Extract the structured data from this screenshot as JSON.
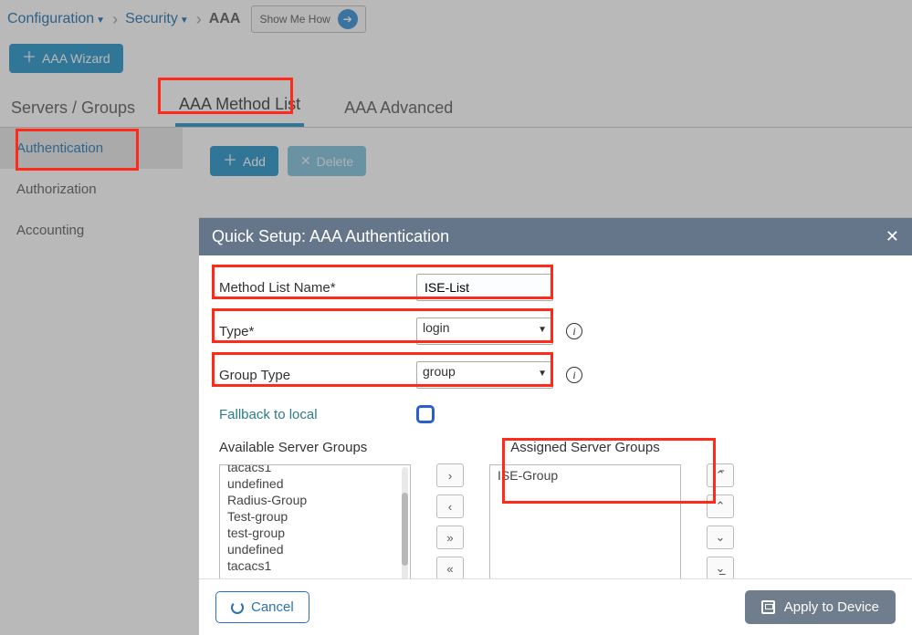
{
  "breadcrumb": {
    "items": [
      "Configuration",
      "Security",
      "AAA"
    ],
    "help_label": "Show Me How"
  },
  "wizard_button": "AAA Wizard",
  "tabs": {
    "servers": "Servers / Groups",
    "method_list": "AAA Method List",
    "advanced": "AAA Advanced"
  },
  "sidebar": {
    "authentication": "Authentication",
    "authorization": "Authorization",
    "accounting": "Accounting"
  },
  "actions": {
    "add": "Add",
    "delete": "Delete"
  },
  "modal": {
    "title": "Quick Setup: AAA Authentication",
    "fields": {
      "method_list_name_label": "Method List Name*",
      "method_list_name_value": "ISE-List",
      "type_label": "Type*",
      "type_value": "login",
      "group_type_label": "Group Type",
      "group_type_value": "group",
      "fallback_label": "Fallback to local"
    },
    "available_title": "Available Server Groups",
    "assigned_title": "Assigned Server Groups",
    "available_items": [
      "tacacs1",
      "undefined",
      "Radius-Group",
      "Test-group",
      "test-group",
      "undefined",
      "tacacs1"
    ],
    "assigned_items": [
      "ISE-Group"
    ],
    "footer": {
      "cancel": "Cancel",
      "apply": "Apply to Device"
    }
  }
}
